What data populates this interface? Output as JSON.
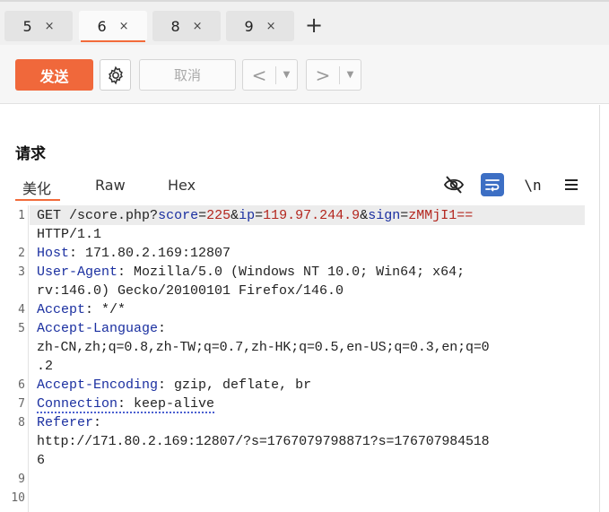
{
  "tabs": [
    {
      "label": "5",
      "close": "×",
      "active": false
    },
    {
      "label": "6",
      "close": "×",
      "active": true
    },
    {
      "label": "8",
      "close": "×",
      "active": false
    },
    {
      "label": "9",
      "close": "×",
      "active": false
    }
  ],
  "add_tab": "+",
  "toolbar": {
    "send_label": "发送",
    "cancel_label": "取消",
    "back_arrow": "<",
    "forward_arrow": ">",
    "dropdown_arrow": "▼"
  },
  "panel": {
    "title": "请求",
    "subtabs": [
      "美化",
      "Raw",
      "Hex"
    ],
    "newline_toggle": "\\n",
    "icons": [
      "eye-slash-icon",
      "wrap-lines-icon",
      "newline-icon",
      "menu-icon"
    ]
  },
  "request": {
    "line_numbers": [
      "1",
      "2",
      "3",
      "4",
      "5",
      "6",
      "7",
      "8",
      "9",
      "10"
    ],
    "method": "GET",
    "path": "/score.php?",
    "params": [
      {
        "key": "score",
        "value": "225"
      },
      {
        "key": "ip",
        "value": "119.97.244.9"
      },
      {
        "key": "sign",
        "value": "zMMjI1=="
      }
    ],
    "version": "HTTP/1.1",
    "headers": [
      {
        "name": "Host",
        "value": "171.80.2.169:12807"
      },
      {
        "name": "User-Agent",
        "value": "Mozilla/5.0 (Windows NT 10.0; Win64; x64;",
        "value_cont": "rv:146.0) Gecko/20100101 Firefox/146.0"
      },
      {
        "name": "Accept",
        "value": "*/*"
      },
      {
        "name": "Accept-Language",
        "value": "zh-CN,zh;q=0.8,zh-TW;q=0.7,zh-HK;q=0.5,en-US;q=0.3,en;q=0",
        "value_cont": ".2"
      },
      {
        "name": "Accept-Encoding",
        "value": "gzip, deflate, br"
      },
      {
        "name": "Connection",
        "value": "keep-alive"
      },
      {
        "name": "Referer",
        "value": "http://171.80.2.169:12807/?s=1767079798871?s=176707984518",
        "value_cont": "6"
      }
    ]
  },
  "colors": {
    "accent": "#f0683b",
    "header_name": "#1a2fa0",
    "param_value": "#b3261e",
    "wrap_icon_bg": "#3d6fc4"
  }
}
